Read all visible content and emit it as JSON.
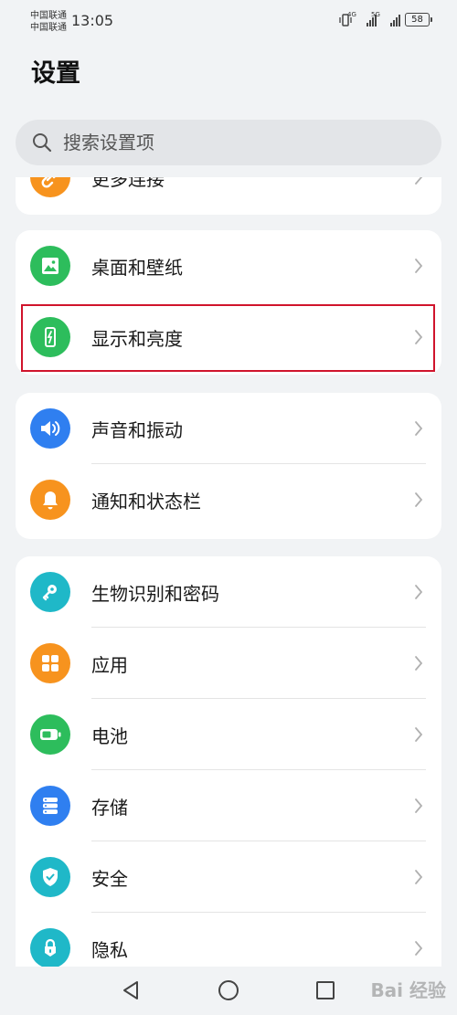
{
  "status_bar": {
    "carrier_1": "中国联通",
    "carrier_2": "中国联通",
    "time": "13:05",
    "network_1": "4G",
    "network_2": "5G",
    "battery": "58"
  },
  "page_title": "设置",
  "search": {
    "placeholder": "搜索设置项"
  },
  "cards": [
    {
      "items": [
        {
          "label": "更多连接",
          "icon": "link-icon",
          "color": "#f7931e"
        }
      ]
    },
    {
      "items": [
        {
          "label": "桌面和壁纸",
          "icon": "image-icon",
          "color": "#2dbd5c"
        },
        {
          "label": "显示和亮度",
          "icon": "brightness-icon",
          "color": "#2dbd5c"
        }
      ]
    },
    {
      "items": [
        {
          "label": "声音和振动",
          "icon": "speaker-icon",
          "color": "#2f7ff0"
        },
        {
          "label": "通知和状态栏",
          "icon": "bell-icon",
          "color": "#f7931e"
        }
      ]
    },
    {
      "items": [
        {
          "label": "生物识别和密码",
          "icon": "key-icon",
          "color": "#1fb8c8"
        },
        {
          "label": "应用",
          "icon": "apps-icon",
          "color": "#f7931e"
        },
        {
          "label": "电池",
          "icon": "battery-icon",
          "color": "#2dbd5c"
        },
        {
          "label": "存储",
          "icon": "storage-icon",
          "color": "#2f7ff0"
        },
        {
          "label": "安全",
          "icon": "shield-icon",
          "color": "#1fb8c8"
        },
        {
          "label": "隐私",
          "icon": "privacy-lock-icon",
          "color": "#1fb8c8"
        }
      ]
    }
  ],
  "watermark": "Bai 经验"
}
